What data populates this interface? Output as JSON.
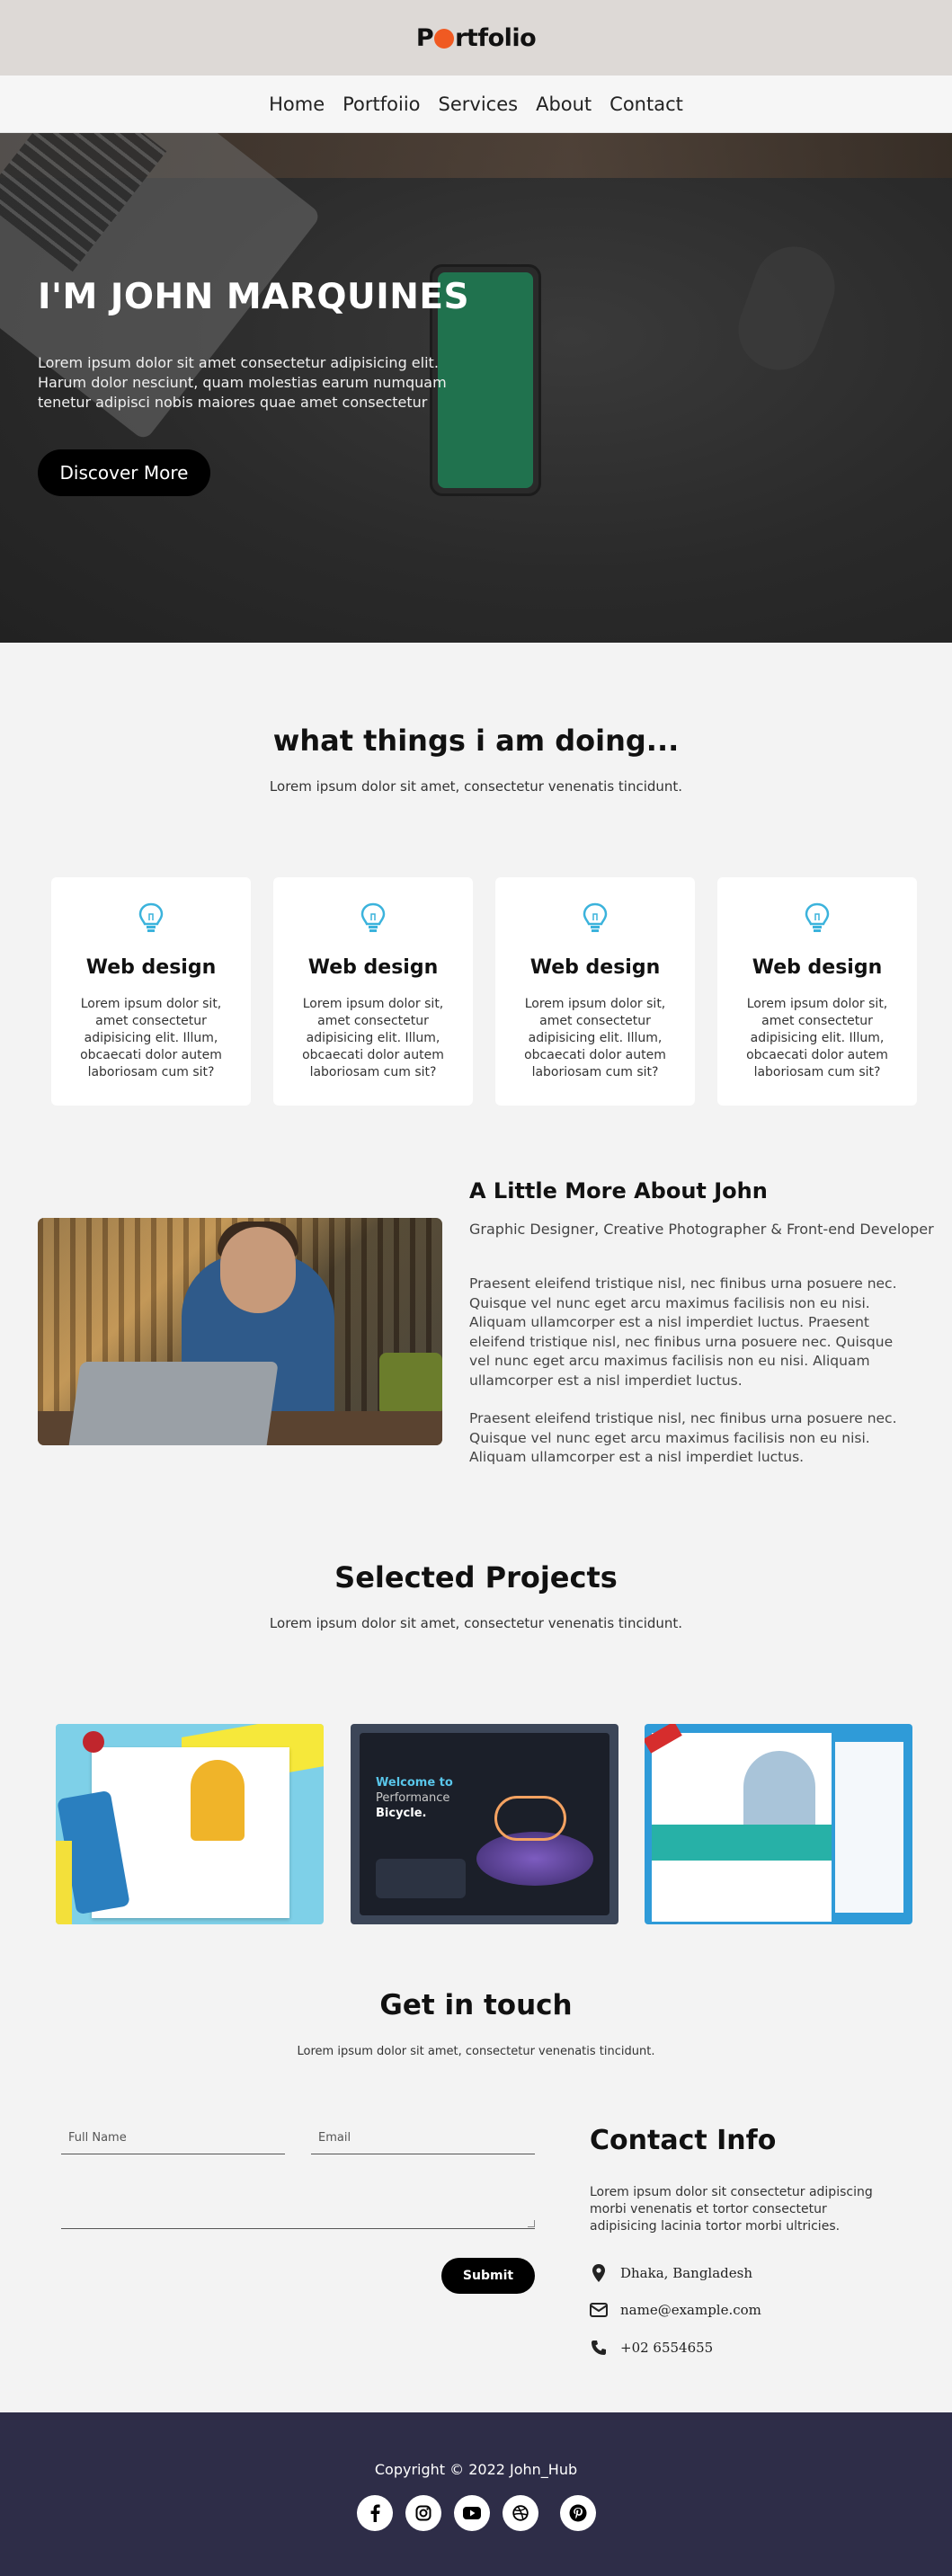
{
  "header": {
    "logo_prefix": "P",
    "logo_suffix": "rtfolio",
    "nav": [
      "Home",
      "Portfoiio",
      "Services",
      "About",
      "Contact"
    ]
  },
  "hero": {
    "title": "I'M JOHN MARQUINES",
    "text": "Lorem ipsum dolor sit amet consectetur adipisicing elit. Harum dolor nesciunt, quam molestias earum numquam tenetur adipisci nobis maiores quae amet consectetur",
    "button": "Discover More"
  },
  "services": {
    "title": "what things i am doing...",
    "subtitle": "Lorem ipsum dolor sit amet, consectetur venenatis tincidunt.",
    "cards": [
      {
        "icon": "lightbulb-icon",
        "title": "Web design",
        "text": "Lorem ipsum dolor sit, amet consectetur adipisicing elit. Illum, obcaecati dolor autem laboriosam cum sit?"
      },
      {
        "icon": "lightbulb-icon",
        "title": "Web design",
        "text": "Lorem ipsum dolor sit, amet consectetur adipisicing elit. Illum, obcaecati dolor autem laboriosam cum sit?"
      },
      {
        "icon": "lightbulb-icon",
        "title": "Web design",
        "text": "Lorem ipsum dolor sit, amet consectetur adipisicing elit. Illum, obcaecati dolor autem laboriosam cum sit?"
      },
      {
        "icon": "lightbulb-icon",
        "title": "Web design",
        "text": "Lorem ipsum dolor sit, amet consectetur adipisicing elit. Illum, obcaecati dolor autem laboriosam cum sit?"
      }
    ]
  },
  "about": {
    "title": "A Little More About John",
    "subtitle": "Graphic Designer, Creative Photographer & Front-end Developer",
    "paragraph1": "Praesent eleifend tristique nisl, nec finibus urna posuere nec. Quisque vel nunc eget arcu maximus facilisis non eu nisi. Aliquam ullamcorper est a nisl imperdiet luctus. Praesent eleifend tristique nisl, nec finibus urna posuere nec. Quisque vel nunc eget arcu maximus facilisis non eu nisi. Aliquam ullamcorper est a nisl imperdiet luctus.",
    "paragraph2": "Praesent eleifend tristique nisl, nec finibus urna posuere nec. Quisque vel nunc eget arcu maximus facilisis non eu nisi. Aliquam ullamcorper est a nisl imperdiet luctus."
  },
  "projects": {
    "title": "Selected Projects",
    "subtitle": "Lorem ipsum dolor sit amet, consectetur venenatis tincidunt.",
    "p2_heading1": "Welcome to",
    "p2_heading2": "Performance",
    "p2_heading3": "Bicycle."
  },
  "contact": {
    "title": "Get in touch",
    "subtitle": "Lorem ipsum dolor sit amet, consectetur venenatis tincidunt.",
    "fullname_placeholder": "Full Name",
    "email_placeholder": "Email",
    "submit": "Submit",
    "info_title": "Contact Info",
    "info_text": "Lorem ipsum dolor sit consectetur adipiscing morbi venenatis et tortor consectetur adipisicing lacinia tortor morbi ultricies.",
    "address": "Dhaka, Bangladesh",
    "email": "name@example.com",
    "phone": "+02 6554655"
  },
  "footer": {
    "copyright": "Copyright © 2022 John_Hub",
    "socials": [
      "facebook-icon",
      "instagram-icon",
      "youtube-icon",
      "dribbble-icon",
      "pinterest-icon"
    ]
  },
  "colors": {
    "accent": "#f05a22",
    "icon_blue": "#3bb3dc",
    "footer_bg": "#2e2d48"
  }
}
